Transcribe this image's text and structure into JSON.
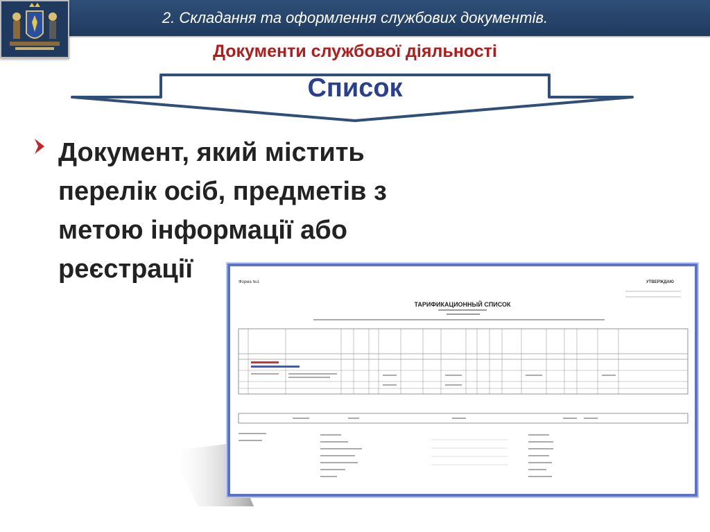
{
  "header": {
    "title": "2. Складання та оформлення службових документів."
  },
  "subtitle": "Документи службової діяльності",
  "banner": {
    "label": "Список"
  },
  "body": {
    "lines": [
      "Документ, який містить",
      "перелік осіб, предметів з",
      "метою інформації або",
      "реєстрації"
    ]
  },
  "document_image": {
    "title": "ТАРИФИКАЦИОННЫЙ СПИСОК",
    "corner_left": "Форма №1",
    "corner_right": "УТВЕРЖДАЮ"
  },
  "colors": {
    "header_bg": "#1f3a5e",
    "subtitle": "#b21b1b",
    "banner_text": "#2b3f8f",
    "bullet": "#c0262c",
    "doc_border": "#5a73c8"
  }
}
